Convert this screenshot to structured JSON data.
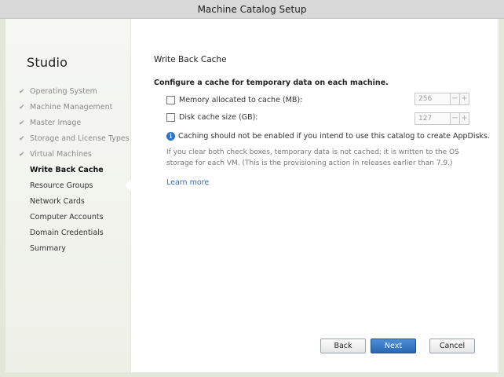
{
  "window": {
    "title": "Machine Catalog Setup"
  },
  "sidebar": {
    "brand": "Studio",
    "steps": [
      {
        "label": "Operating System",
        "state": "done"
      },
      {
        "label": "Machine Management",
        "state": "done"
      },
      {
        "label": "Master Image",
        "state": "done"
      },
      {
        "label": "Storage and License Types",
        "state": "done"
      },
      {
        "label": "Virtual Machines",
        "state": "done"
      },
      {
        "label": "Write Back Cache",
        "state": "current"
      },
      {
        "label": "Resource Groups",
        "state": "pending"
      },
      {
        "label": "Network Cards",
        "state": "pending"
      },
      {
        "label": "Computer Accounts",
        "state": "pending"
      },
      {
        "label": "Domain Credentials",
        "state": "pending"
      },
      {
        "label": "Summary",
        "state": "pending"
      }
    ],
    "check_glyph": "✔"
  },
  "main": {
    "heading": "Write Back Cache",
    "subheading": "Configure a cache for temporary data on each machine.",
    "memory": {
      "label": "Memory allocated to cache (MB):",
      "checked": false,
      "value": "256"
    },
    "disk": {
      "label": "Disk cache size (GB):",
      "checked": false,
      "value": "127"
    },
    "info": "Caching should not be enabled if you intend to use this catalog to create AppDisks.",
    "note": "If you clear both check boxes, temporary data is not cached; it is written to the OS storage for each VM. (This is the provisioning action in releases earlier than 7.9.)",
    "learn_more": "Learn more",
    "minus": "−",
    "plus": "+"
  },
  "footer": {
    "back": "Back",
    "next": "Next",
    "cancel": "Cancel"
  },
  "colors": {
    "accent": "#2a66b4",
    "link": "#2a6fc0",
    "info": "#2a73c8"
  }
}
